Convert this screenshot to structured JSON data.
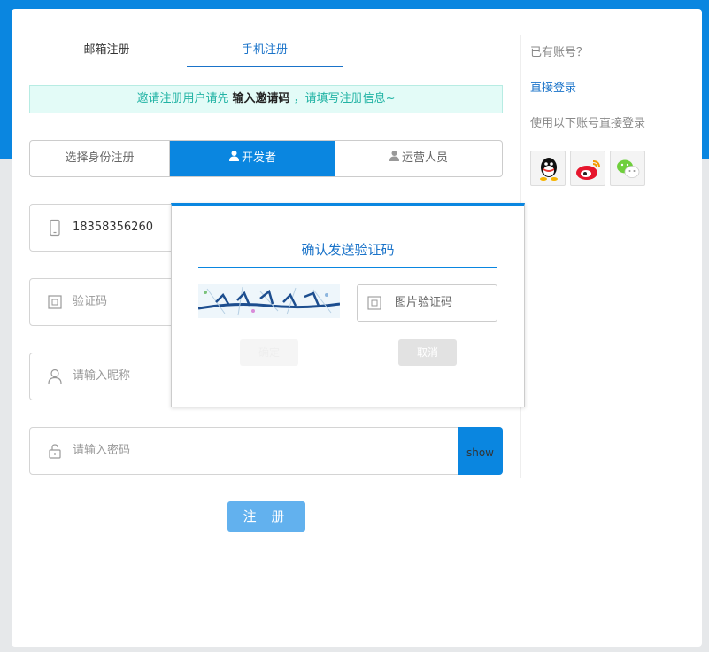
{
  "tabs": {
    "email": "邮箱注册",
    "phone": "手机注册"
  },
  "invite": {
    "before": "邀请注册用户请先",
    "strong": "输入邀请码",
    "after": "，请填写注册信息~"
  },
  "roles": {
    "choose": "选择身份注册",
    "developer": "开发者",
    "operator": "运营人员"
  },
  "form": {
    "phone_value": "18358356260",
    "sms_code_placeholder": "验证码",
    "nickname_placeholder": "请输入昵称",
    "password_placeholder": "请输入密码",
    "show_label": "show",
    "submit_label": "注 册"
  },
  "side": {
    "has_account": "已有账号？",
    "login_link": "直接登录",
    "social_hint": "使用以下账号直接登录",
    "social_icons": [
      "qq-icon",
      "weibo-icon",
      "wechat-icon"
    ]
  },
  "modal": {
    "title": "确认发送验证码",
    "captcha_placeholder": "图片验证码",
    "confirm_label": "确定",
    "cancel_label": "取消"
  },
  "colors": {
    "primary": "#0a86e0",
    "link": "#1a73c9",
    "invite_text": "#21b3a4",
    "submit": "#62b1ee"
  }
}
